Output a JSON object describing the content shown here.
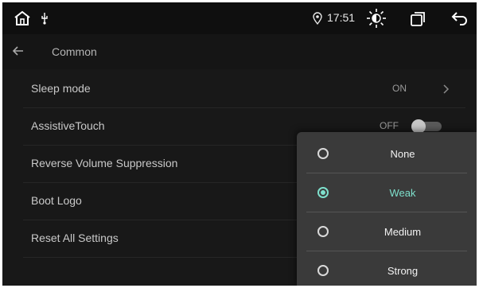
{
  "statusbar": {
    "time": "17:51",
    "icons": [
      "home-icon",
      "usb-icon",
      "location-icon",
      "brightness-icon",
      "recent-apps-icon",
      "return-icon"
    ]
  },
  "header": {
    "title": "Common"
  },
  "settings": [
    {
      "label": "Sleep mode",
      "value": "ON"
    },
    {
      "label": "AssistiveTouch",
      "value": "OFF",
      "toggle_on": false
    },
    {
      "label": "Reverse Volume Suppression"
    },
    {
      "label": "Boot Logo"
    },
    {
      "label": "Reset All Settings"
    }
  ],
  "popup": {
    "options": [
      "None",
      "Weak",
      "Medium",
      "Strong"
    ],
    "selected": "Weak"
  },
  "colors": {
    "accent": "#7ee0cc",
    "background": "#181818",
    "popup_background": "#3a3a3a"
  }
}
